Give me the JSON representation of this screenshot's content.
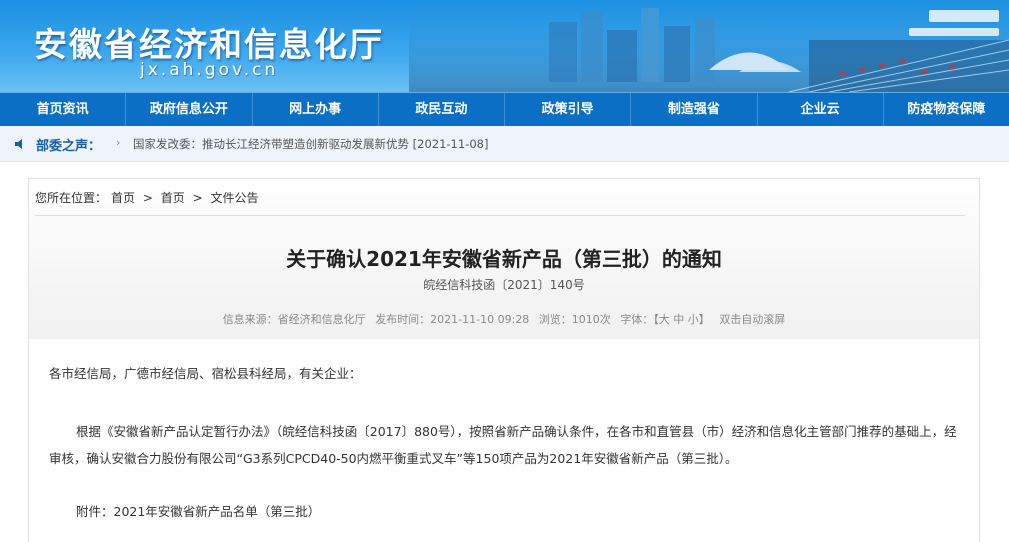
{
  "header": {
    "site_title": "安徽省经济和信息化厅",
    "domain": "jx.ah.gov.cn"
  },
  "nav": {
    "items": [
      "首页资讯",
      "政府信息公开",
      "网上办事",
      "政民互动",
      "政策引导",
      "制造强省",
      "企业云",
      "防疫物资保障"
    ]
  },
  "ticker": {
    "label": "部委之声：",
    "text": "国家发改委：推动长江经济带塑造创新驱动发展新优势 [2021-11-08]"
  },
  "breadcrumb": {
    "prefix": "您所在位置：",
    "items": [
      "首页",
      "首页",
      "文件公告"
    ],
    "sep": ">"
  },
  "article": {
    "title": "关于确认2021年安徽省新产品（第三批）的通知",
    "number": "皖经信科技函〔2021〕140号",
    "meta": {
      "source": "信息来源：省经济和信息化厅",
      "time": "发布时间：2021-11-10 09:28",
      "views": "浏览：1010次",
      "font_label": "字体：",
      "font_options": "【大 中 小】",
      "autoscroll": "双击自动滚屏"
    },
    "p1": "各市经信局，广德市经信局、宿松县科经局，有关企业：",
    "p2": "根据《安徽省新产品认定暂行办法》（皖经信科技函〔2017〕880号），按照省新产品确认条件，在各市和直管县（市）经济和信息化主管部门推荐的基础上，经审核，确认安徽合力股份有限公司“G3系列CPCD40-50内燃平衡重式叉车”等150项产品为2021年安徽省新产品（第三批）。",
    "attachment": "附件：2021年安徽省新产品名单（第三批）"
  },
  "colors": {
    "nav_bg": "#0b6fc5",
    "header_blue": "#1c8fe0",
    "ticker_label": "#1760a8"
  }
}
